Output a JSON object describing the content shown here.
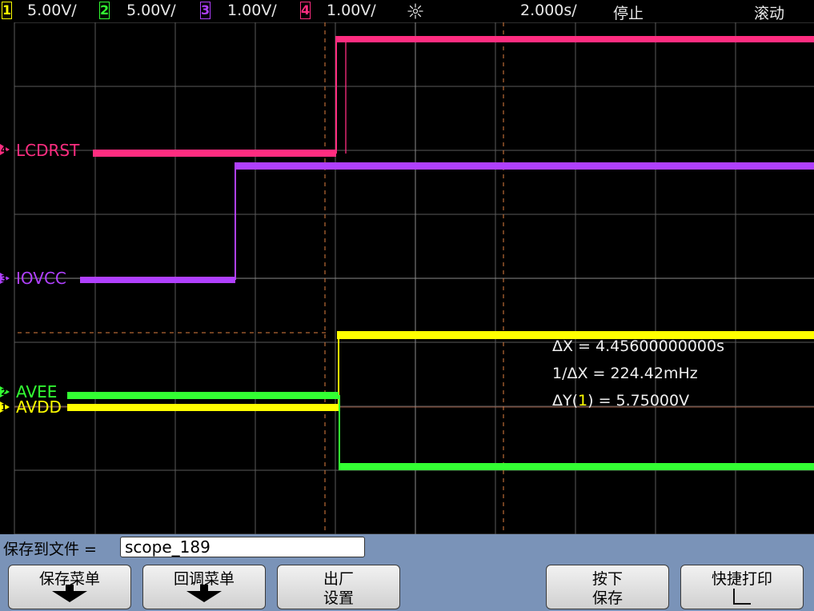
{
  "header": {
    "channels": [
      {
        "num": "1",
        "scale": "5.00V/",
        "color": "#ffff00"
      },
      {
        "num": "2",
        "scale": "5.00V/",
        "color": "#33ff33"
      },
      {
        "num": "3",
        "scale": "1.00V/",
        "color": "#b040ff"
      },
      {
        "num": "4",
        "scale": "1.00V/",
        "color": "#ff2d80"
      }
    ],
    "timebase": "2.000s/",
    "run_state": "停止",
    "mode": "滚动"
  },
  "traces": {
    "lcdrst": {
      "label": "LCDRST",
      "color": "#ff2d80",
      "marker": "4"
    },
    "iovcc": {
      "label": "IOVCC",
      "color": "#b040ff",
      "marker": "3"
    },
    "avee": {
      "label": "AVEE",
      "color": "#33ff33",
      "marker": "2"
    },
    "avdd": {
      "label": "AVDD",
      "color": "#ffff00",
      "marker": "1"
    }
  },
  "measurements": {
    "delta_x": "ΔX = 4.45600000000s",
    "inv_delta_x": "1/ΔX = 224.42mHz",
    "delta_y_prefix": "ΔY(",
    "delta_y_channel": "1",
    "delta_y_suffix": ") = 5.75000V"
  },
  "save": {
    "label": "保存到文件 =",
    "filename": "scope_189"
  },
  "softkeys": {
    "save_menu": "保存菜单",
    "recall_menu": "回调菜单",
    "factory_l1": "出厂",
    "factory_l2": "设置",
    "press_l1": "按下",
    "press_l2": "保存",
    "quick_print": "快捷打印"
  }
}
